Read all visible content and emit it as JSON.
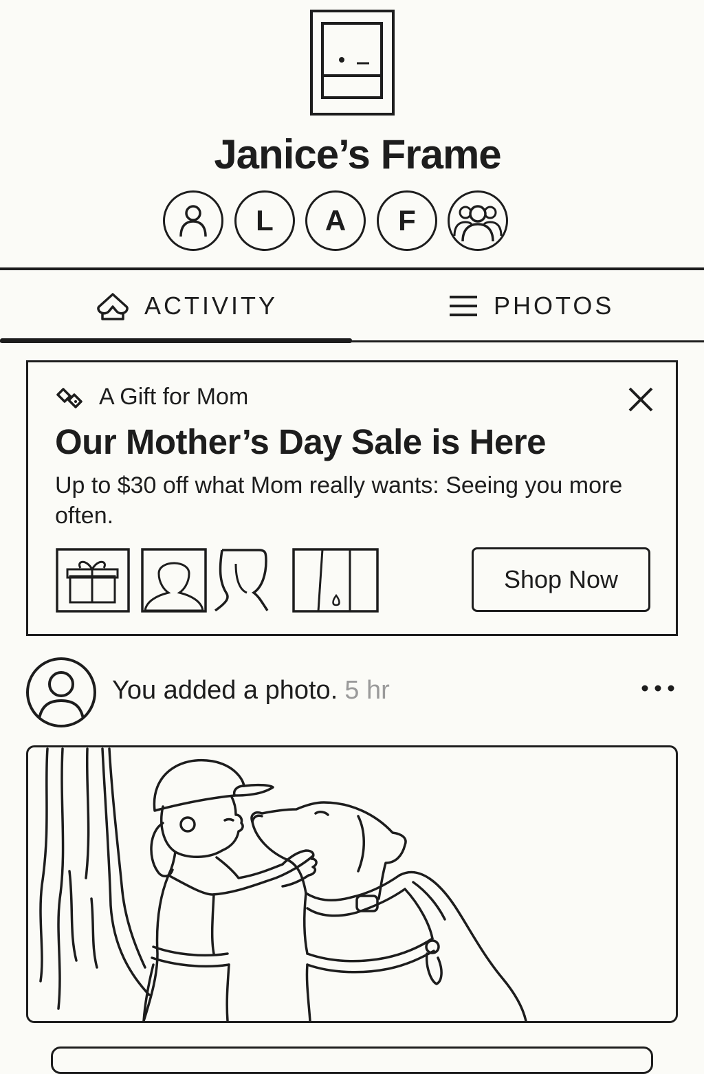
{
  "header": {
    "title": "Janice’s Frame",
    "members": [
      {
        "type": "icon",
        "icon": "person-icon"
      },
      {
        "type": "initial",
        "initial": "L"
      },
      {
        "type": "initial",
        "initial": "A"
      },
      {
        "type": "initial",
        "initial": "F"
      },
      {
        "type": "icon",
        "icon": "group-icon"
      }
    ]
  },
  "tabs": [
    {
      "label": "ACTIVITY",
      "icon": "home-heart-icon",
      "selected": true
    },
    {
      "label": "PHOTOS",
      "icon": "menu-icon",
      "selected": false
    }
  ],
  "promo": {
    "kicker": "A Gift for Mom",
    "kicker_icon": "tag-icon",
    "headline": "Our Mother’s Day Sale is Here",
    "body": "Up to $30 off what Mom really wants: Seeing you more often.",
    "button_label": "Shop Now"
  },
  "activity": {
    "action": "You added a photo.",
    "time": "5 hr"
  }
}
